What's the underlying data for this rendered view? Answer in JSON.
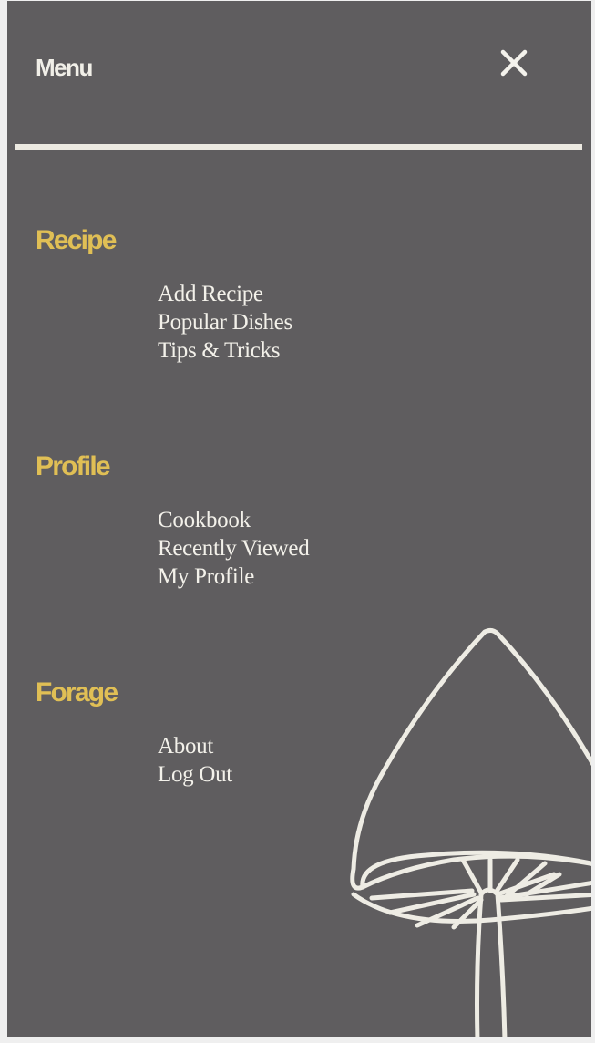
{
  "header": {
    "title": "Menu",
    "close_icon": "close-icon"
  },
  "colors": {
    "background": "#5f5d5f",
    "accent": "#e0bf55",
    "text": "#f3f1ea"
  },
  "sections": [
    {
      "title": "Recipe",
      "items": [
        "Add Recipe",
        "Popular Dishes",
        "Tips & Tricks"
      ]
    },
    {
      "title": "Profile",
      "items": [
        "Cookbook",
        "Recently Viewed",
        "My Profile"
      ]
    },
    {
      "title": "Forage",
      "items": [
        "About",
        "Log Out"
      ]
    }
  ],
  "decoration": {
    "icon": "mushroom-illustration"
  }
}
